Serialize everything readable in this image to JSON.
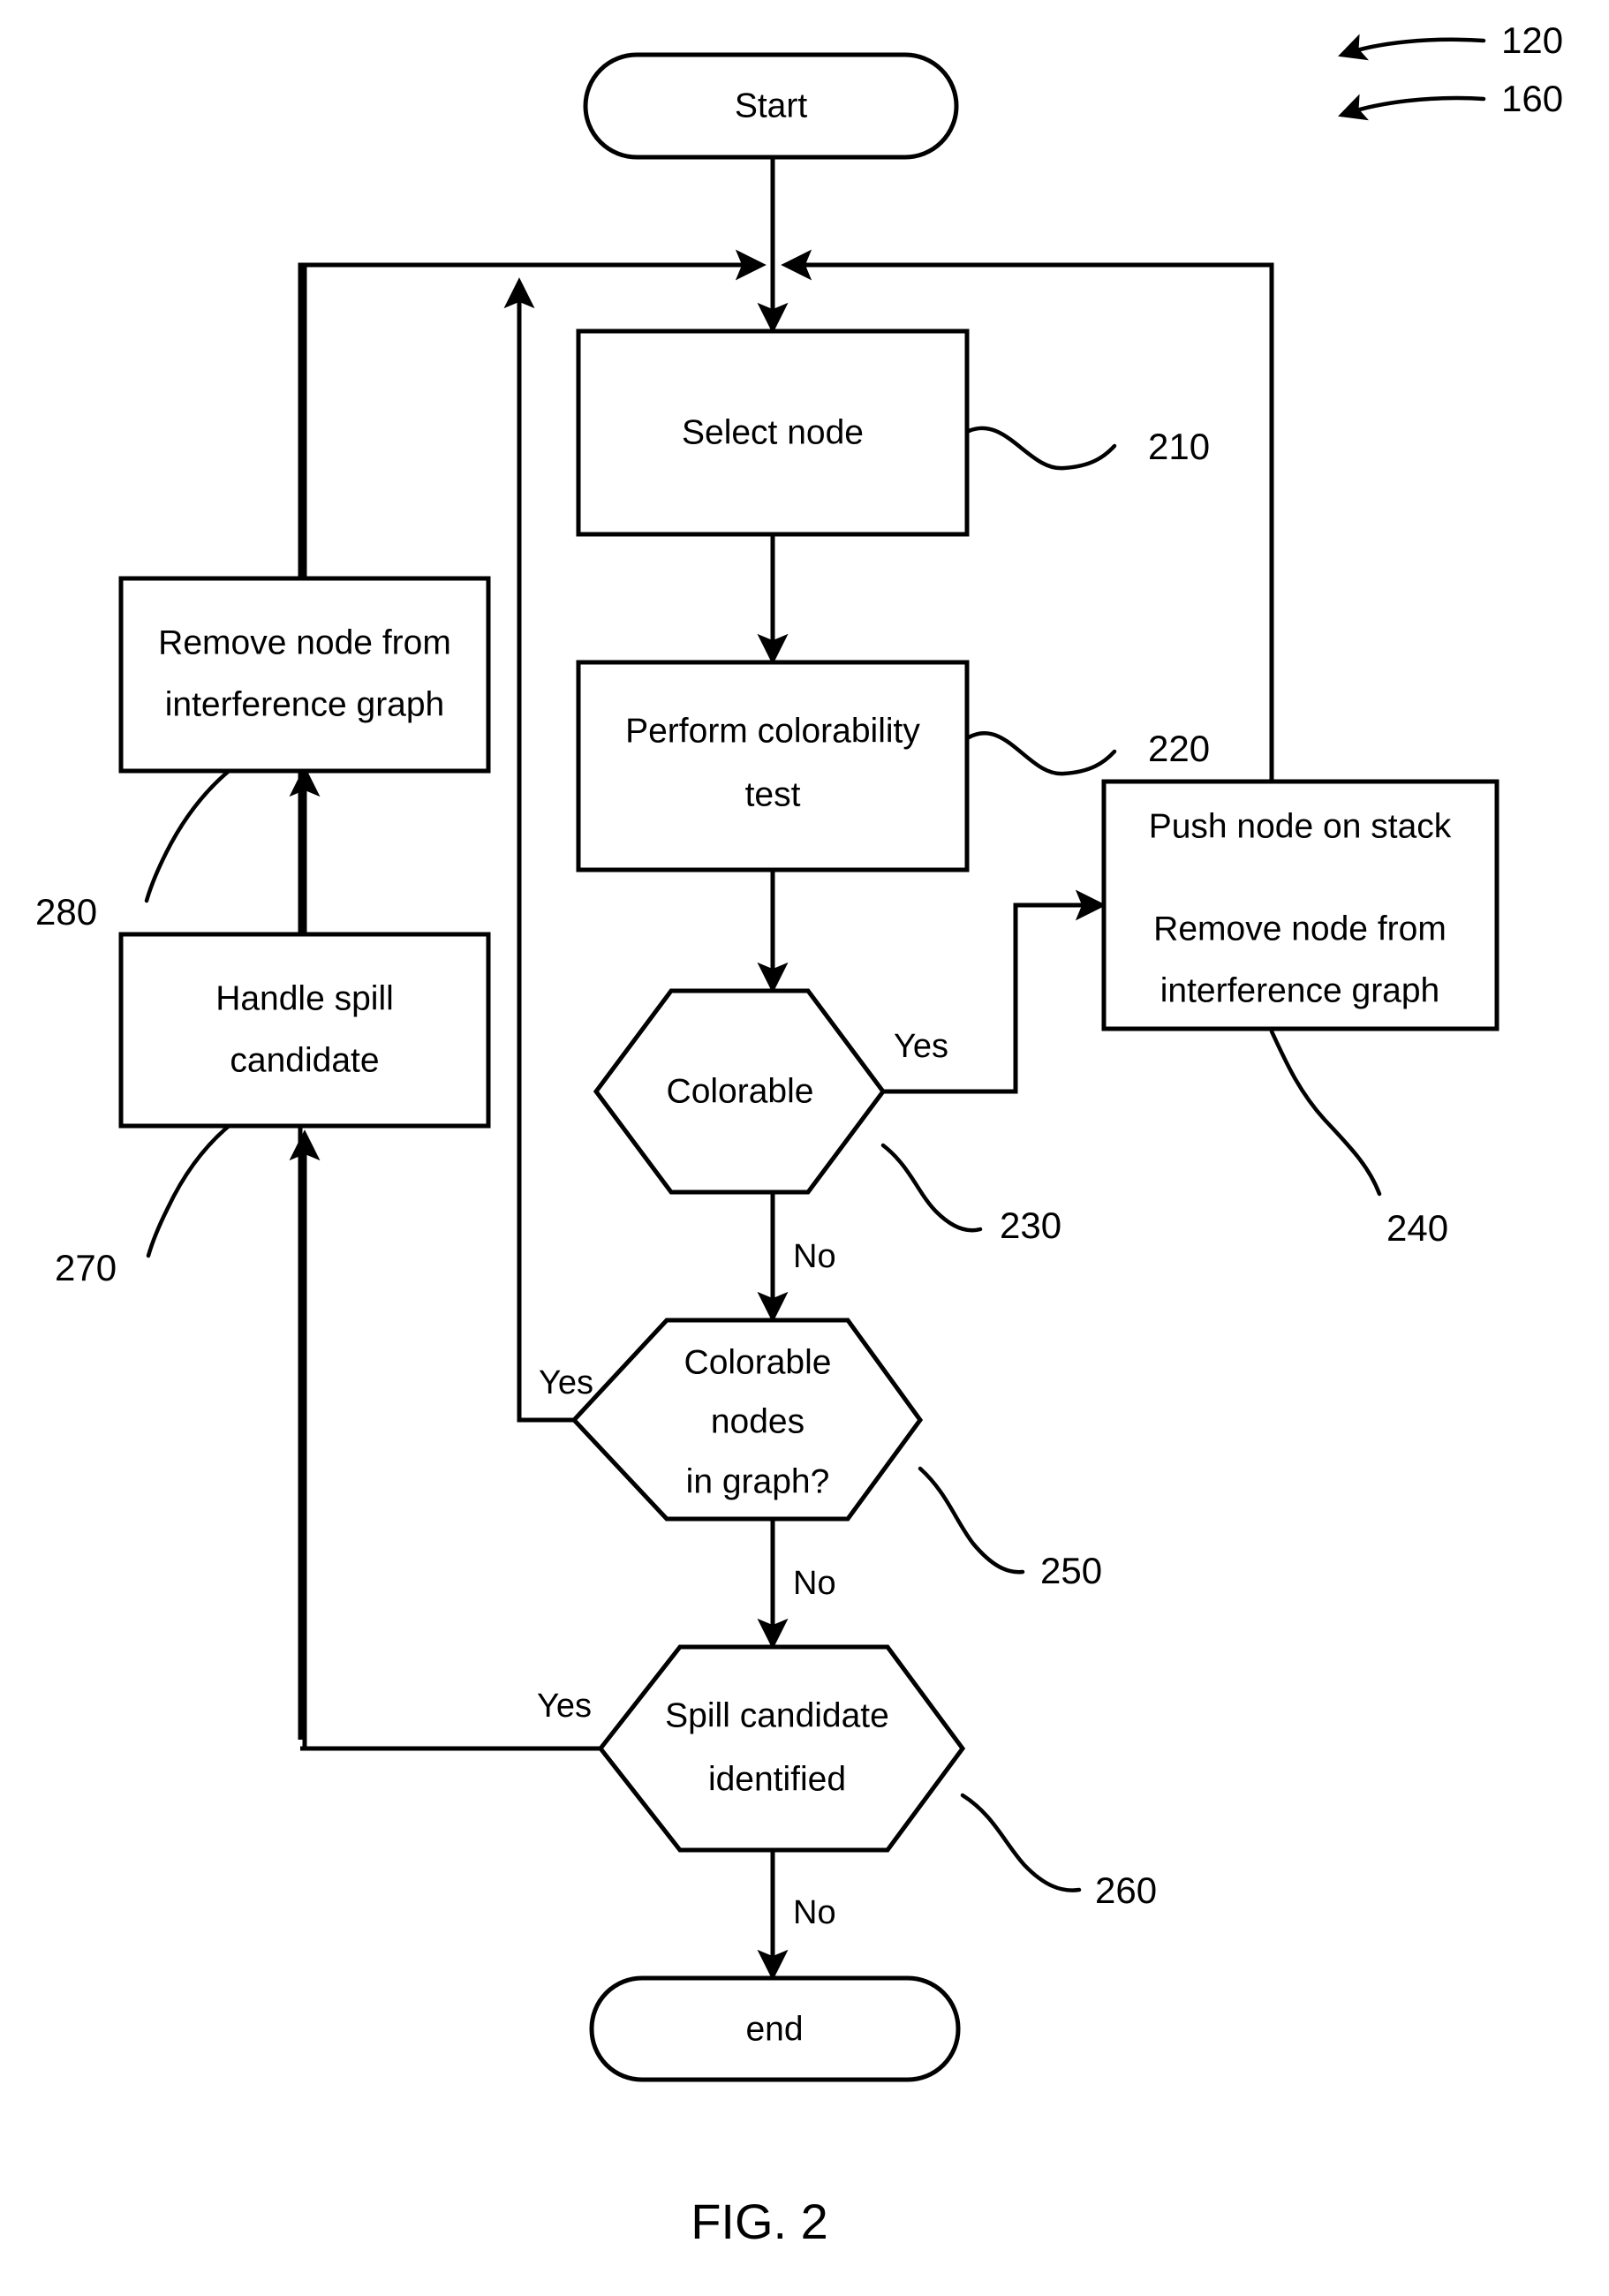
{
  "figure": {
    "caption": "FIG. 2",
    "top_refs": [
      {
        "label": "120"
      },
      {
        "label": "160"
      }
    ]
  },
  "nodes": {
    "start": {
      "label": "Start",
      "shape": "terminator"
    },
    "select_node": {
      "label": "Select node",
      "shape": "process",
      "ref": "210"
    },
    "colorability_test": {
      "line1": "Perform colorability",
      "line2": "test",
      "shape": "process",
      "ref": "220"
    },
    "colorable": {
      "label": "Colorable",
      "shape": "decision",
      "ref": "230"
    },
    "push_node": {
      "line1": "Push node on stack",
      "line2": "Remove node from",
      "line3": "interference graph",
      "shape": "process",
      "ref": "240"
    },
    "colorable_nodes": {
      "line1": "Colorable",
      "line2": "nodes",
      "line3": "in graph?",
      "shape": "decision",
      "ref": "250"
    },
    "spill_identified": {
      "line1": "Spill candidate",
      "line2": "identified",
      "shape": "decision",
      "ref": "260"
    },
    "handle_spill": {
      "line1": "Handle spill",
      "line2": "candidate",
      "shape": "process",
      "ref": "270"
    },
    "remove_node": {
      "line1": "Remove node from",
      "line2": "interference graph",
      "shape": "process",
      "ref": "280"
    },
    "end": {
      "label": "end",
      "shape": "terminator"
    }
  },
  "branch_labels": {
    "colorable_yes": "Yes",
    "colorable_no": "No",
    "colorable_nodes_yes": "Yes",
    "colorable_nodes_no": "No",
    "spill_yes": "Yes",
    "spill_no": "No"
  },
  "colors": {
    "stroke": "#000000",
    "fill": "#ffffff",
    "background": "#ffffff"
  }
}
